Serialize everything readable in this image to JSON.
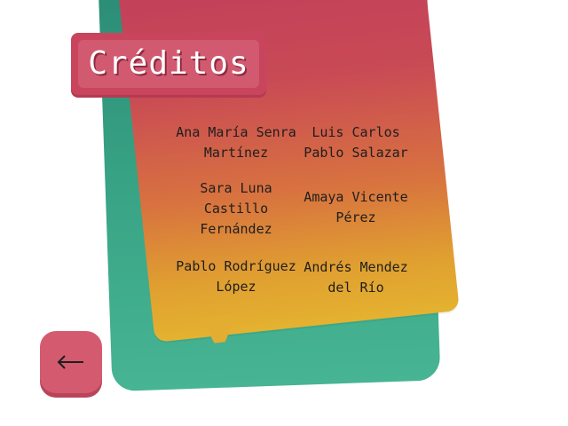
{
  "title": "Créditos",
  "credits": [
    {
      "line1": "Ana María Senra",
      "line2": "Martínez",
      "line3": ""
    },
    {
      "line1": "Luis Carlos",
      "line2": "Pablo Salazar",
      "line3": ""
    },
    {
      "line1": "Sara Luna",
      "line2": "Castillo",
      "line3": "Fernández"
    },
    {
      "line1": "Amaya Vicente",
      "line2": "Pérez",
      "line3": ""
    },
    {
      "line1": "Pablo Rodríguez",
      "line2": "López",
      "line3": ""
    },
    {
      "line1": "Andrés Mendez",
      "line2": "del Río",
      "line3": ""
    }
  ],
  "back_button": {
    "icon": "arrow-left-icon"
  },
  "colors": {
    "card_front_top": "#c2405a",
    "card_front_bottom": "#e4b230",
    "card_back": "#39a586",
    "title_bg": "#d25a70",
    "button_bg": "#d45b6f"
  }
}
